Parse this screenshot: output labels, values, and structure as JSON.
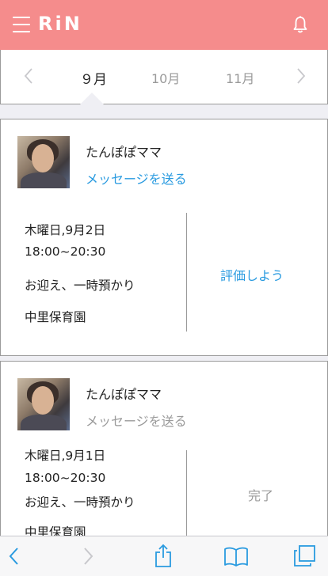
{
  "app": {
    "logo_text": "RiN"
  },
  "header": {
    "menu_icon": "hamburger-menu-icon",
    "bell_icon": "bell-icon",
    "background": "#f58c8c"
  },
  "months": {
    "active": "９月",
    "next1": "10月",
    "next2": "11月"
  },
  "cards": [
    {
      "user_name": "たんぽぽママ",
      "message_link": "メッセージを送る",
      "date": "木曜日,9月2日",
      "time": "18:00~20:30",
      "service": "お迎え、一時預かり",
      "place": "中里保育園",
      "action": "評価しよう"
    },
    {
      "user_name": "たんぽぽママ",
      "message_link": "メッセージを送る",
      "date": "木曜日,9月1日",
      "time": "18:00~20:30",
      "service": "お迎え、一時預かり",
      "place": "中里保育園",
      "action": "完了"
    }
  ],
  "colors": {
    "accent_blue": "#2a9be0",
    "muted_gray": "#9a9a9a",
    "header_pink": "#f58c8c"
  }
}
